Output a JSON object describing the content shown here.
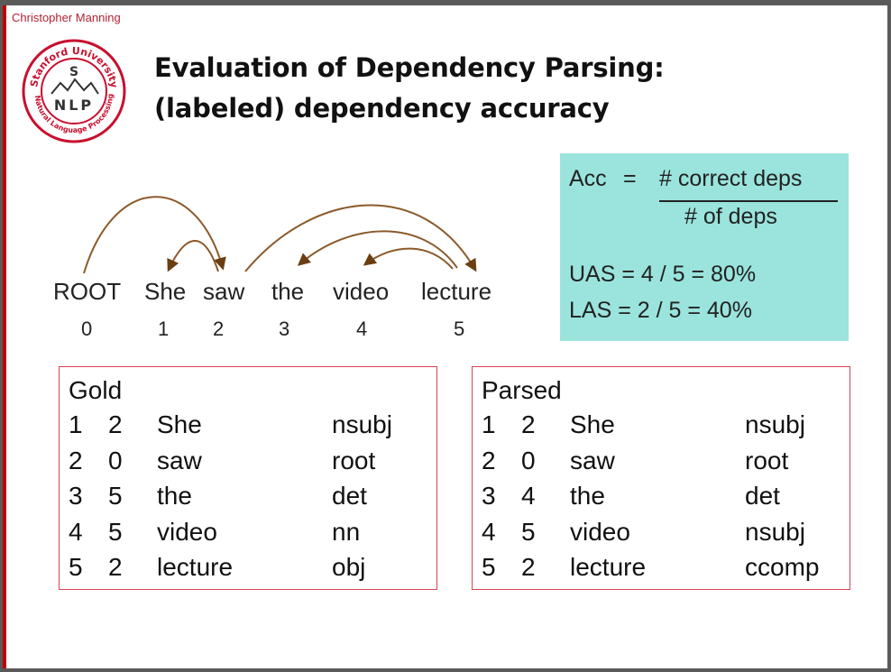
{
  "author": "Christopher Manning",
  "logo": {
    "top_text": "Stanford University",
    "bottom_text": "Natural Language Processing",
    "letters": "NLP",
    "center_letter": "S"
  },
  "title": {
    "line1": "Evaluation of Dependency Parsing:",
    "line2": "(labeled) dependency accuracy"
  },
  "sentence": {
    "words": [
      "ROOT",
      "She",
      "saw",
      "the",
      "video",
      "lecture"
    ],
    "indices": [
      "0",
      "1",
      "2",
      "3",
      "4",
      "5"
    ]
  },
  "metrics": {
    "acc_label": "Acc",
    "eq": "=",
    "numerator": "# correct deps",
    "denominator": "# of deps",
    "uas": "UAS = 4 / 5 = 80%",
    "las": "LAS = 2 / 5 = 40%"
  },
  "gold": {
    "title": "Gold",
    "rows": [
      [
        "1",
        "2",
        "She",
        "nsubj"
      ],
      [
        "2",
        "0",
        "saw",
        "root"
      ],
      [
        "3",
        "5",
        "the",
        "det"
      ],
      [
        "4",
        "5",
        "video",
        "nn"
      ],
      [
        "5",
        "2",
        "lecture",
        "obj"
      ]
    ]
  },
  "parsed": {
    "title": "Parsed",
    "rows": [
      [
        "1",
        "2",
        "She",
        "nsubj"
      ],
      [
        "2",
        "0",
        "saw",
        "root"
      ],
      [
        "3",
        "4",
        "the",
        "det"
      ],
      [
        "4",
        "5",
        "video",
        "nsubj"
      ],
      [
        "5",
        "2",
        "lecture",
        "ccomp"
      ]
    ]
  },
  "colors": {
    "arc": "#8b5a2b",
    "metrics_bg": "#9ae4dd",
    "table_border": "#d9434f",
    "accent_red": "#c00000"
  }
}
